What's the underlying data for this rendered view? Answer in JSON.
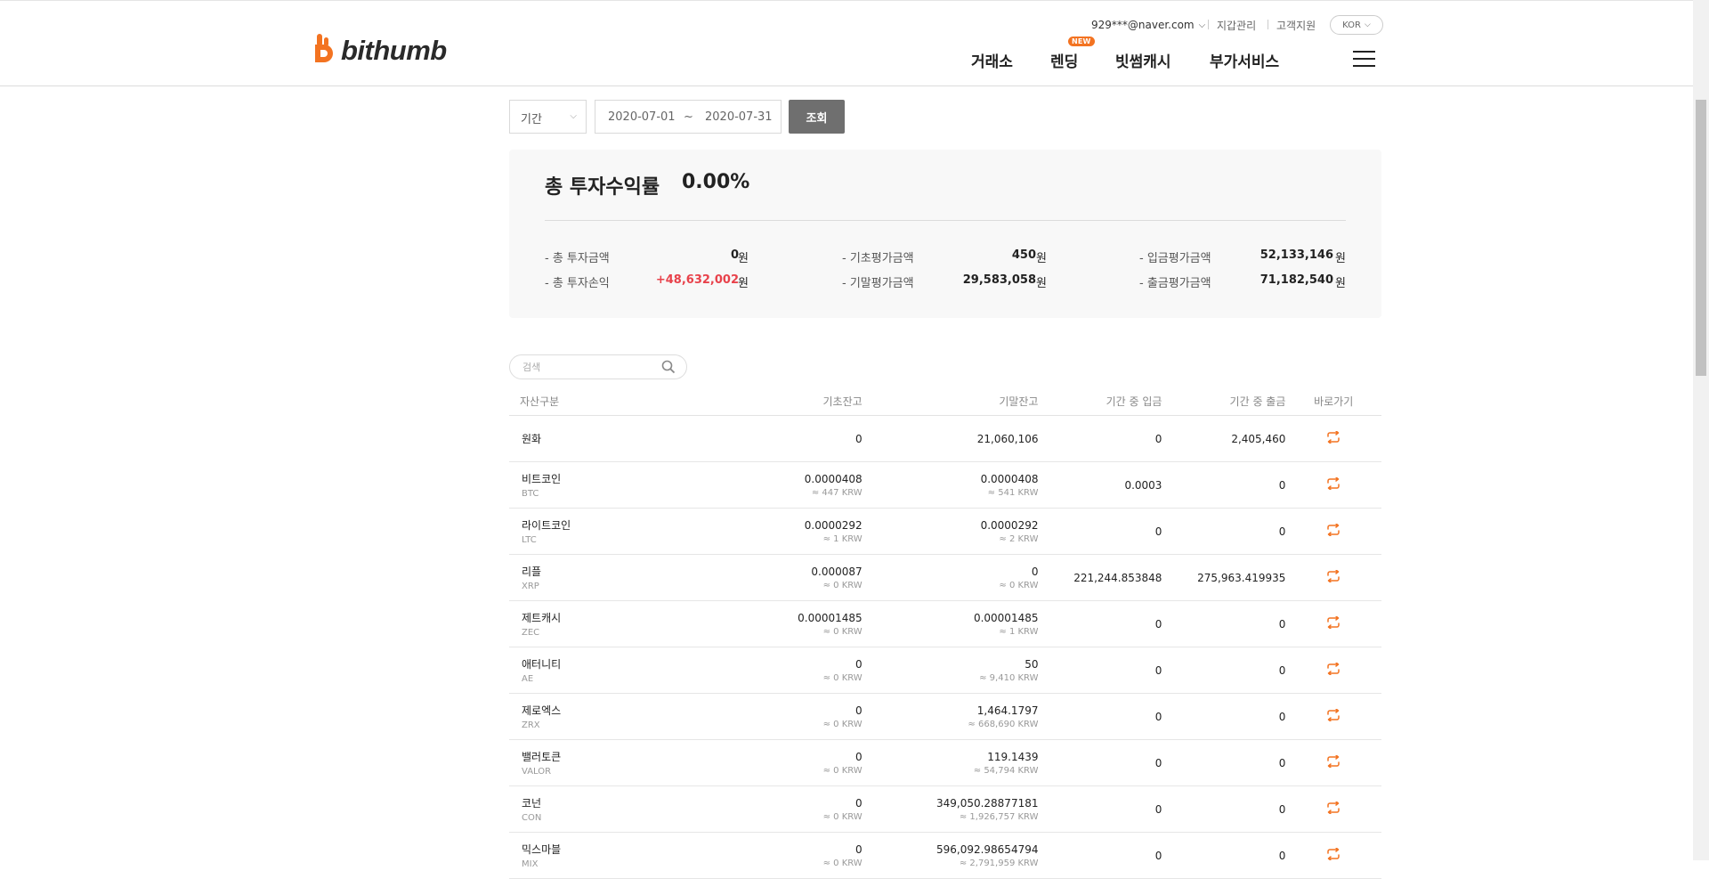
{
  "header": {
    "logo_text": "bithumb",
    "user_email": "929***@naver.com",
    "wallet_link": "지갑관리",
    "support_link": "고객지원",
    "lang": "KOR",
    "nav": {
      "exchange": "거래소",
      "lending": "렌딩",
      "lending_badge": "NEW",
      "cash": "빗썸캐시",
      "addon": "부가서비스"
    },
    "brand_color": "#f37321"
  },
  "filter": {
    "period_label": "기간",
    "date_start": "2020-07-01",
    "date_sep": "~",
    "date_end": "2020-07-31",
    "search_button": "조회"
  },
  "summary": {
    "title": "총 투자수익률",
    "rate": "0.00%",
    "items": {
      "total_invest": {
        "label": "- 총 투자금액",
        "value": "0",
        "unit": "원"
      },
      "total_profit": {
        "label": "- 총 투자손익",
        "value": "+48,632,002",
        "unit": "원"
      },
      "begin_eval": {
        "label": "- 기초평가금액",
        "value": "450",
        "unit": "원"
      },
      "end_eval": {
        "label": "- 기말평가금액",
        "value": "29,583,058",
        "unit": "원"
      },
      "deposit_eval": {
        "label": "- 입금평가금액",
        "value": "52,133,146",
        "unit": "원"
      },
      "withdraw_eval": {
        "label": "- 출금평가금액",
        "value": "71,182,540",
        "unit": "원"
      }
    }
  },
  "list": {
    "search_placeholder": "검색",
    "columns": {
      "asset": "자산구분",
      "begin": "기초잔고",
      "end": "기말잔고",
      "deposit": "기간 중 입금",
      "withdraw": "기간 중 출금",
      "go": "바로가기"
    },
    "rows": [
      {
        "name": "원화",
        "symbol": "",
        "begin": "0",
        "begin_krw": "",
        "end": "21,060,106",
        "end_krw": "",
        "deposit": "0",
        "withdraw": "2,405,460"
      },
      {
        "name": "비트코인",
        "symbol": "BTC",
        "begin": "0.0000408",
        "begin_krw": "≈ 447 KRW",
        "end": "0.0000408",
        "end_krw": "≈ 541 KRW",
        "deposit": "0.0003",
        "withdraw": "0"
      },
      {
        "name": "라이트코인",
        "symbol": "LTC",
        "begin": "0.0000292",
        "begin_krw": "≈ 1 KRW",
        "end": "0.0000292",
        "end_krw": "≈ 2 KRW",
        "deposit": "0",
        "withdraw": "0"
      },
      {
        "name": "리플",
        "symbol": "XRP",
        "begin": "0.000087",
        "begin_krw": "≈ 0 KRW",
        "end": "0",
        "end_krw": "≈ 0 KRW",
        "deposit": "221,244.853848",
        "withdraw": "275,963.419935"
      },
      {
        "name": "제트캐시",
        "symbol": "ZEC",
        "begin": "0.00001485",
        "begin_krw": "≈ 0 KRW",
        "end": "0.00001485",
        "end_krw": "≈ 1 KRW",
        "deposit": "0",
        "withdraw": "0"
      },
      {
        "name": "애터니티",
        "symbol": "AE",
        "begin": "0",
        "begin_krw": "≈ 0 KRW",
        "end": "50",
        "end_krw": "≈ 9,410 KRW",
        "deposit": "0",
        "withdraw": "0"
      },
      {
        "name": "제로엑스",
        "symbol": "ZRX",
        "begin": "0",
        "begin_krw": "≈ 0 KRW",
        "end": "1,464.1797",
        "end_krw": "≈ 668,690 KRW",
        "deposit": "0",
        "withdraw": "0"
      },
      {
        "name": "밸러토큰",
        "symbol": "VALOR",
        "begin": "0",
        "begin_krw": "≈ 0 KRW",
        "end": "119.1439",
        "end_krw": "≈ 54,794 KRW",
        "deposit": "0",
        "withdraw": "0"
      },
      {
        "name": "코넌",
        "symbol": "CON",
        "begin": "0",
        "begin_krw": "≈ 0 KRW",
        "end": "349,050.28877181",
        "end_krw": "≈ 1,926,757 KRW",
        "deposit": "0",
        "withdraw": "0"
      },
      {
        "name": "믹스마블",
        "symbol": "MIX",
        "begin": "0",
        "begin_krw": "≈ 0 KRW",
        "end": "596,092.98654794",
        "end_krw": "≈ 2,791,959 KRW",
        "deposit": "0",
        "withdraw": "0"
      }
    ]
  }
}
